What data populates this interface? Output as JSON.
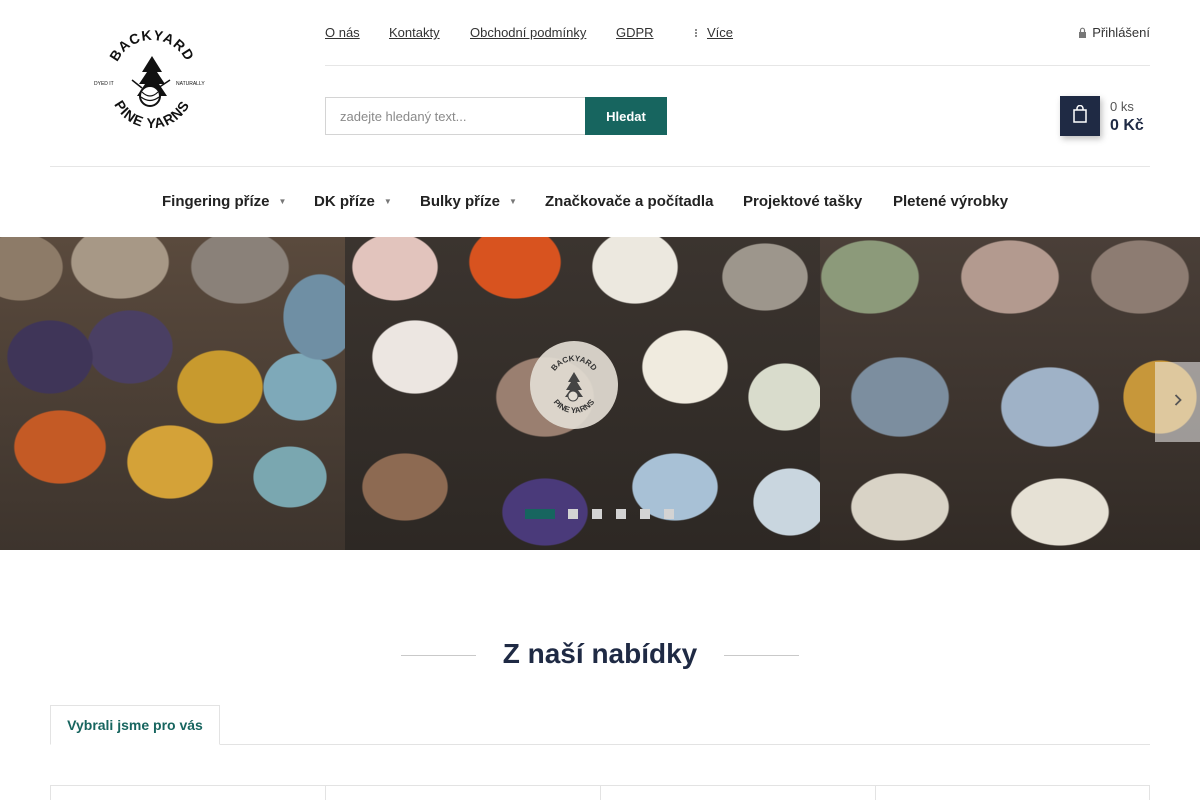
{
  "header": {
    "top_links": [
      "O nás",
      "Kontakty",
      "Obchodní podmínky",
      "GDPR"
    ],
    "more_label": "Více",
    "login_label": "Přihlášení",
    "search": {
      "placeholder": "zadejte hledaný text...",
      "button_label": "Hledat"
    },
    "cart": {
      "count": "0 ks",
      "price": "0 Kč"
    },
    "logo": {
      "line1": "BACKYARD",
      "line2": "PINE YARNS",
      "left": "DYED IT",
      "right": "NATURALLY"
    }
  },
  "nav": {
    "items": [
      {
        "label": "Fingering příze",
        "has_dropdown": true
      },
      {
        "label": "DK příze",
        "has_dropdown": true
      },
      {
        "label": "Bulky příze",
        "has_dropdown": true
      },
      {
        "label": "Značkovače a počítadla",
        "has_dropdown": false
      },
      {
        "label": "Projektové tašky",
        "has_dropdown": false
      },
      {
        "label": "Pletené výrobky",
        "has_dropdown": false
      }
    ]
  },
  "hero": {
    "slide_count": 6,
    "active_slide": 1
  },
  "section": {
    "title": "Z naší nabídky",
    "tabs": [
      {
        "label": "Vybrali jsme pro vás"
      }
    ]
  },
  "colors": {
    "accent": "#17655f",
    "navy": "#1f2a44"
  }
}
